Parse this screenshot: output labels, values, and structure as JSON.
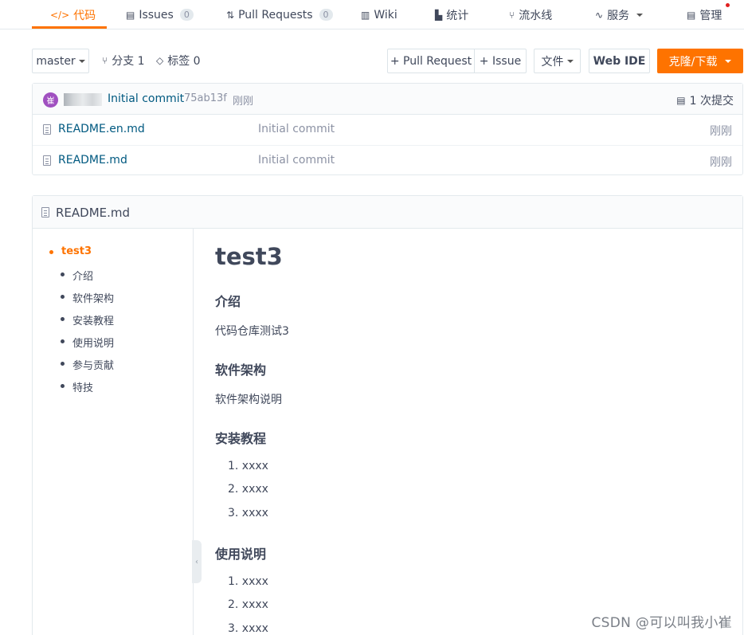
{
  "nav": {
    "tabs": [
      {
        "label": "代码",
        "icon": "code-icon",
        "active": true
      },
      {
        "label": "Issues",
        "icon": "issues-icon",
        "count": "0"
      },
      {
        "label": "Pull Requests",
        "icon": "pull-request-icon",
        "count": "0"
      },
      {
        "label": "Wiki",
        "icon": "wiki-icon"
      },
      {
        "label": "统计",
        "icon": "stats-icon"
      },
      {
        "label": "流水线",
        "icon": "pipeline-icon"
      },
      {
        "label": "服务",
        "icon": "pulse-icon"
      },
      {
        "label": "管理",
        "icon": "manage-icon"
      }
    ],
    "accent": "#fe7300"
  },
  "toolbar": {
    "branch": "master",
    "branches_label": "分支 1",
    "tags_label": "标签 0",
    "pull_request_label": "+ Pull Request",
    "issue_label": "+ Issue",
    "file_label": "文件",
    "web_ide_label": "Web IDE",
    "clone_label": "克隆/下载"
  },
  "commit": {
    "avatar_text": "崔",
    "message": "Initial commit",
    "sha": "75ab13f",
    "time": "刚刚",
    "count_label": "1 次提交"
  },
  "files": [
    {
      "name": "README.en.md",
      "message": "Initial commit",
      "time": "刚刚"
    },
    {
      "name": "README.md",
      "message": "Initial commit",
      "time": "刚刚"
    }
  ],
  "readme": {
    "title": "README.md",
    "toc": [
      "test3",
      "介绍",
      "软件架构",
      "安装教程",
      "使用说明",
      "参与贡献",
      "特技"
    ],
    "h1": "test3",
    "sections": {
      "intro_h": "介绍",
      "intro_p": "代码仓库测试3",
      "arch_h": "软件架构",
      "arch_p": "软件架构说明",
      "install_h": "安装教程",
      "install_items": [
        "1. xxxx",
        "2. xxxx",
        "3. xxxx"
      ],
      "usage_h": "使用说明",
      "usage_items": [
        "1. xxxx",
        "2. xxxx",
        "3. xxxx"
      ]
    }
  },
  "watermark": "CSDN @可以叫我小崔"
}
